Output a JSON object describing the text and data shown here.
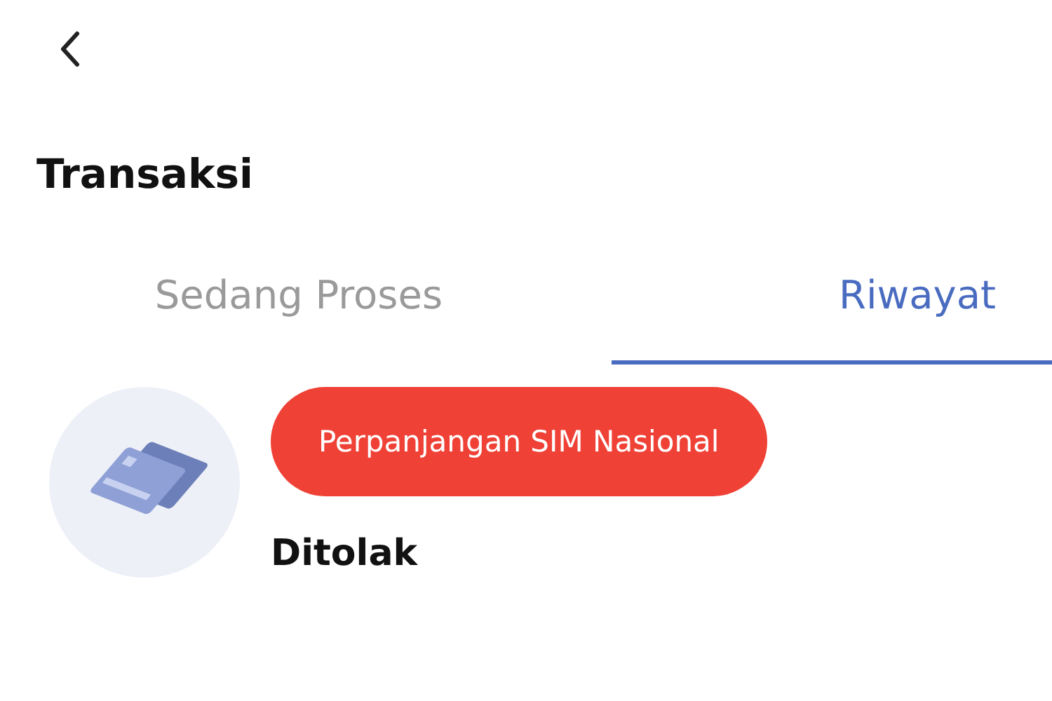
{
  "header": {
    "title": "Transaksi"
  },
  "tabs": [
    {
      "label": "Sedang Proses",
      "selected": false
    },
    {
      "label": "Riwayat",
      "selected": true
    }
  ],
  "transactions": [
    {
      "service": "Perpanjangan SIM Nasional",
      "status": "Ditolak",
      "color": "#ef4136"
    }
  ]
}
